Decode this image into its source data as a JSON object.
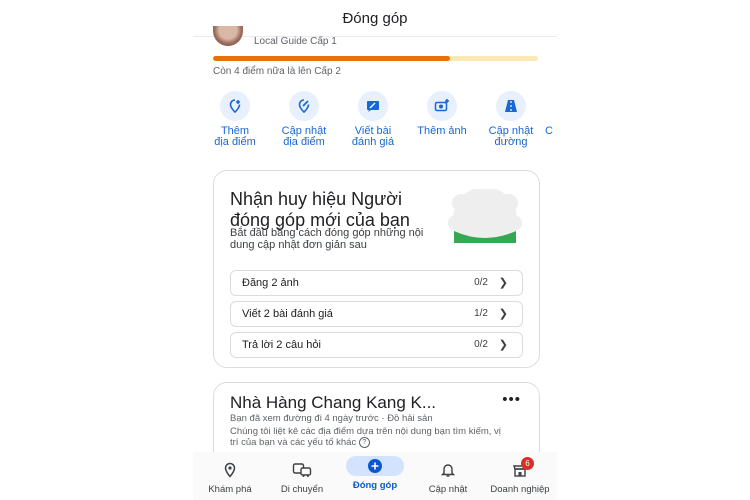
{
  "header": {
    "title": "Đóng góp"
  },
  "profile": {
    "level_text": "Local Guide Cấp 1",
    "progress": 0.73,
    "remaining_text": "Còn 4 điểm nữa là lên Cấp 2"
  },
  "actions": [
    {
      "label": "Thêm\nđịa điểm",
      "icon": "add-location-icon"
    },
    {
      "label": "Cập nhật\nđịa điểm",
      "icon": "edit-location-icon"
    },
    {
      "label": "Viết bài\nđánh giá",
      "icon": "write-review-icon"
    },
    {
      "label": "Thêm ảnh",
      "icon": "add-photo-icon"
    },
    {
      "label": "Cập nhật\nđường",
      "icon": "road-icon"
    }
  ],
  "badge_card": {
    "title": "Nhận huy hiệu Người đóng góp mới của bạn",
    "subtitle": "Bắt đầu bằng cách đóng góp những nội dung cập nhật đơn giản sau",
    "tasks": [
      {
        "label": "Đăng 2 ảnh",
        "progress": "0/2"
      },
      {
        "label": "Viết 2 bài đánh giá",
        "progress": "1/2"
      },
      {
        "label": "Trả lời 2 câu hỏi",
        "progress": "0/2"
      }
    ]
  },
  "place_card": {
    "title": "Nhà Hàng Chang Kang K...",
    "meta": "Bạn đã xem đường đi 4 ngày trước · Đồ hải sản",
    "description": "Chúng tôi liệt kê các địa điểm dựa trên nội dung bạn tìm kiếm, vị trí của bạn và các yếu tố khác"
  },
  "bottom_nav": [
    {
      "label": "Khám phá",
      "icon": "explore-pin-icon"
    },
    {
      "label": "Di chuyển",
      "icon": "commute-icon"
    },
    {
      "label": "Đóng góp",
      "icon": "add-circle-icon"
    },
    {
      "label": "Cập nhật",
      "icon": "bell-icon"
    },
    {
      "label": "Doanh nghiệp",
      "icon": "business-icon",
      "badge": "6"
    }
  ],
  "colors": {
    "accent": "#1967d2",
    "progress": "#e8710a",
    "progress_bg": "#fce8b2",
    "badge_green": "#34a853"
  }
}
